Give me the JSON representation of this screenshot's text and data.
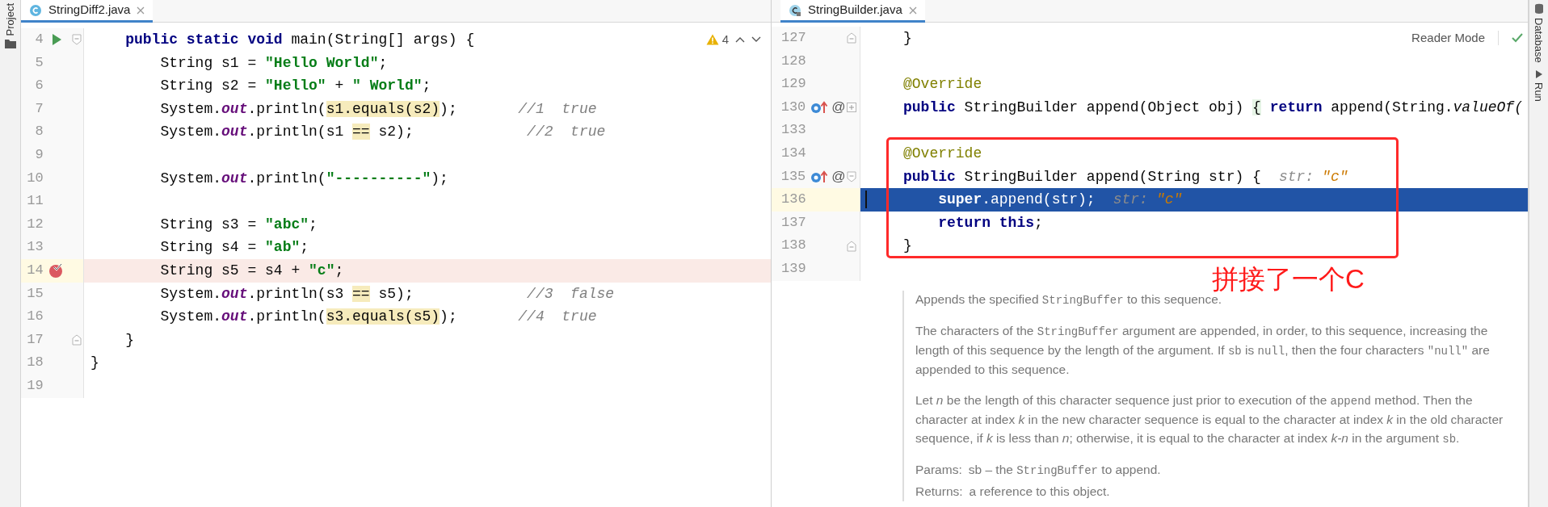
{
  "left_toolstrip": {
    "label": "Project"
  },
  "left_editor": {
    "tab": {
      "title": "StringDiff2.java",
      "selected": true
    },
    "warnings_count": "4",
    "lines": [
      {
        "num": "4",
        "marker": {
          "kind": "run"
        },
        "fold": {
          "kind": "start"
        },
        "tokens": [
          {
            "t": "    public static void",
            "kind": "kw"
          },
          {
            "t": " main(String[] args) {",
            "kind": "plain"
          }
        ]
      },
      {
        "num": "5",
        "tokens": [
          {
            "t": "        String s1 = ",
            "kind": "plain"
          },
          {
            "t": "\"Hello World\"",
            "kind": "str"
          },
          {
            "t": ";",
            "kind": "plain"
          }
        ]
      },
      {
        "num": "6",
        "tokens": [
          {
            "t": "        String s2 = ",
            "kind": "plain"
          },
          {
            "t": "\"Hello\"",
            "kind": "str"
          },
          {
            "t": " + ",
            "kind": "plain"
          },
          {
            "t": "\" World\"",
            "kind": "str"
          },
          {
            "t": ";",
            "kind": "plain"
          }
        ]
      },
      {
        "num": "7",
        "tokens": [
          {
            "t": "        System.",
            "kind": "plain"
          },
          {
            "t": "out",
            "kind": "field"
          },
          {
            "t": ".println(",
            "kind": "plain"
          },
          {
            "t": "s1.equals(s2)",
            "kind": "plain",
            "highlighted": true
          },
          {
            "t": ");       ",
            "kind": "plain"
          },
          {
            "t": "//1  true",
            "kind": "comment"
          }
        ]
      },
      {
        "num": "8",
        "tokens": [
          {
            "t": "        System.",
            "kind": "plain"
          },
          {
            "t": "out",
            "kind": "field"
          },
          {
            "t": ".println(s1 ",
            "kind": "plain"
          },
          {
            "t": "==",
            "kind": "plain",
            "highlighted": true
          },
          {
            "t": " s2);             ",
            "kind": "plain"
          },
          {
            "t": "//2  true",
            "kind": "comment"
          }
        ]
      },
      {
        "num": "9"
      },
      {
        "num": "10",
        "tokens": [
          {
            "t": "        System.",
            "kind": "plain"
          },
          {
            "t": "out",
            "kind": "field"
          },
          {
            "t": ".println(",
            "kind": "plain"
          },
          {
            "t": "\"----------\"",
            "kind": "str"
          },
          {
            "t": ");",
            "kind": "plain"
          }
        ]
      },
      {
        "num": "11"
      },
      {
        "num": "12",
        "tokens": [
          {
            "t": "        String s3 = ",
            "kind": "plain"
          },
          {
            "t": "\"abc\"",
            "kind": "str"
          },
          {
            "t": ";",
            "kind": "plain"
          }
        ]
      },
      {
        "num": "13",
        "tokens": [
          {
            "t": "        String s4 = ",
            "kind": "plain"
          },
          {
            "t": "\"ab\"",
            "kind": "str"
          },
          {
            "t": ";",
            "kind": "plain"
          }
        ]
      },
      {
        "num": "14",
        "marker": {
          "kind": "breakpoint"
        },
        "tokens": [
          {
            "t": "        String s5 = s4 + ",
            "kind": "plain"
          },
          {
            "t": "\"c\"",
            "kind": "str"
          },
          {
            "t": ";",
            "kind": "plain"
          }
        ]
      },
      {
        "num": "15",
        "tokens": [
          {
            "t": "        System.",
            "kind": "plain"
          },
          {
            "t": "out",
            "kind": "field"
          },
          {
            "t": ".println(s3 ",
            "kind": "plain"
          },
          {
            "t": "==",
            "kind": "plain",
            "highlighted": true
          },
          {
            "t": " s5);             ",
            "kind": "plain"
          },
          {
            "t": "//3  false",
            "kind": "comment"
          }
        ]
      },
      {
        "num": "16",
        "tokens": [
          {
            "t": "        System.",
            "kind": "plain"
          },
          {
            "t": "out",
            "kind": "field"
          },
          {
            "t": ".println(",
            "kind": "plain"
          },
          {
            "t": "s3.equals(s5)",
            "kind": "plain",
            "highlighted": true
          },
          {
            "t": ");       ",
            "kind": "plain"
          },
          {
            "t": "//4  true",
            "kind": "comment"
          }
        ]
      },
      {
        "num": "17",
        "fold": {
          "kind": "end"
        },
        "tokens": [
          {
            "t": "    }",
            "kind": "plain"
          }
        ]
      },
      {
        "num": "18",
        "tokens": [
          {
            "t": "}",
            "kind": "plain"
          }
        ]
      },
      {
        "num": "19"
      }
    ]
  },
  "right_editor": {
    "tab": {
      "title": "StringBuilder.java",
      "selected": true
    },
    "reader_mode": "Reader Mode",
    "lines": [
      {
        "num": "127",
        "fold": {
          "kind": "end"
        },
        "selected": false,
        "tokens": [
          {
            "t": "}",
            "kind": "plain"
          }
        ]
      },
      {
        "num": "128",
        "selected": false
      },
      {
        "num": "129",
        "selected": false,
        "tokens": [
          {
            "t": "@Override",
            "kind": "ann"
          }
        ]
      },
      {
        "num": "130",
        "marker": {
          "kind": "override"
        },
        "gutter_mark": "@",
        "fold": {
          "kind": "collapsed"
        },
        "selected": false,
        "tokens": [
          {
            "t": "public",
            "kind": "kw"
          },
          {
            "t": " StringBuilder append(Object obj) ",
            "kind": "plain"
          },
          {
            "t": "{",
            "kind": "folded"
          },
          {
            "t": " return",
            "kind": "kw"
          },
          {
            "t": " append(String.",
            "kind": "plain"
          },
          {
            "t": "valueOf(",
            "kind": "italic"
          }
        ]
      },
      {
        "num": "133",
        "selected": false
      },
      {
        "num": "134",
        "selected": false,
        "tokens": [
          {
            "t": "@Override",
            "kind": "ann"
          }
        ]
      },
      {
        "num": "135",
        "marker": {
          "kind": "override"
        },
        "gutter_mark": "@",
        "fold": {
          "kind": "start"
        },
        "selected": false,
        "tokens": [
          {
            "t": "public",
            "kind": "kw"
          },
          {
            "t": " StringBuilder append(String str) {",
            "kind": "plain"
          },
          {
            "t": "str:",
            "kind": "hint"
          },
          {
            "t": "\"c\"",
            "kind": "hintval"
          }
        ]
      },
      {
        "num": "136",
        "selected": true,
        "tokens": [
          {
            "t": "    super",
            "kind": "kw"
          },
          {
            "t": ".append(str);",
            "kind": "plain"
          },
          {
            "t": "str:",
            "kind": "hint"
          },
          {
            "t": "\"c\"",
            "kind": "hintval"
          }
        ]
      },
      {
        "num": "137",
        "selected": false,
        "tokens": [
          {
            "t": "    return this",
            "kind": "kw"
          },
          {
            "t": ";",
            "kind": "plain"
          }
        ]
      },
      {
        "num": "138",
        "fold": {
          "kind": "end"
        },
        "selected": false,
        "tokens": [
          {
            "t": "}",
            "kind": "plain"
          }
        ]
      },
      {
        "num": "139",
        "selected": false
      }
    ],
    "callout": {
      "text": "拼接了一个C"
    },
    "doc": [
      {
        "segments": [
          {
            "t": "Appends the specified ",
            "kind": "text"
          },
          {
            "t": "StringBuffer",
            "kind": "code"
          },
          {
            "t": " to this sequence.",
            "kind": "text"
          }
        ]
      },
      {
        "segments": [
          {
            "t": "The characters of the ",
            "kind": "text"
          },
          {
            "t": "StringBuffer",
            "kind": "code"
          },
          {
            "t": " argument are appended, in order, to this sequence, increasing the length of this sequence by the length of the argument. If ",
            "kind": "text"
          },
          {
            "t": "sb",
            "kind": "code"
          },
          {
            "t": " is ",
            "kind": "text"
          },
          {
            "t": "null",
            "kind": "code"
          },
          {
            "t": ", then the four characters ",
            "kind": "text"
          },
          {
            "t": "\"null\"",
            "kind": "code"
          },
          {
            "t": " are appended to this sequence.",
            "kind": "text"
          }
        ]
      },
      {
        "segments": [
          {
            "t": "Let ",
            "kind": "text"
          },
          {
            "t": "n",
            "kind": "var"
          },
          {
            "t": " be the length of this character sequence just prior to execution of the ",
            "kind": "text"
          },
          {
            "t": "append",
            "kind": "code"
          },
          {
            "t": " method. Then the character at index ",
            "kind": "text"
          },
          {
            "t": "k",
            "kind": "var"
          },
          {
            "t": " in the new character sequence is equal to the character at index ",
            "kind": "text"
          },
          {
            "t": "k",
            "kind": "var"
          },
          {
            "t": " in the old character sequence, if ",
            "kind": "text"
          },
          {
            "t": "k",
            "kind": "var"
          },
          {
            "t": " is less than ",
            "kind": "text"
          },
          {
            "t": "n",
            "kind": "var"
          },
          {
            "t": "; otherwise, it is equal to the character at index ",
            "kind": "text"
          },
          {
            "t": "k-n",
            "kind": "var"
          },
          {
            "t": " in the argument ",
            "kind": "text"
          },
          {
            "t": "sb",
            "kind": "code"
          },
          {
            "t": ".",
            "kind": "text"
          }
        ]
      },
      {
        "label": "Params:",
        "segments": [
          {
            "t": "sb – the ",
            "kind": "text"
          },
          {
            "t": "StringBuffer",
            "kind": "code"
          },
          {
            "t": " to append.",
            "kind": "text"
          }
        ]
      },
      {
        "label": "Returns:",
        "segments": [
          {
            "t": "a reference to this object.",
            "kind": "text"
          }
        ]
      }
    ]
  },
  "right_toolstrip": [
    {
      "label": "Database"
    },
    {
      "label": "Run"
    }
  ]
}
